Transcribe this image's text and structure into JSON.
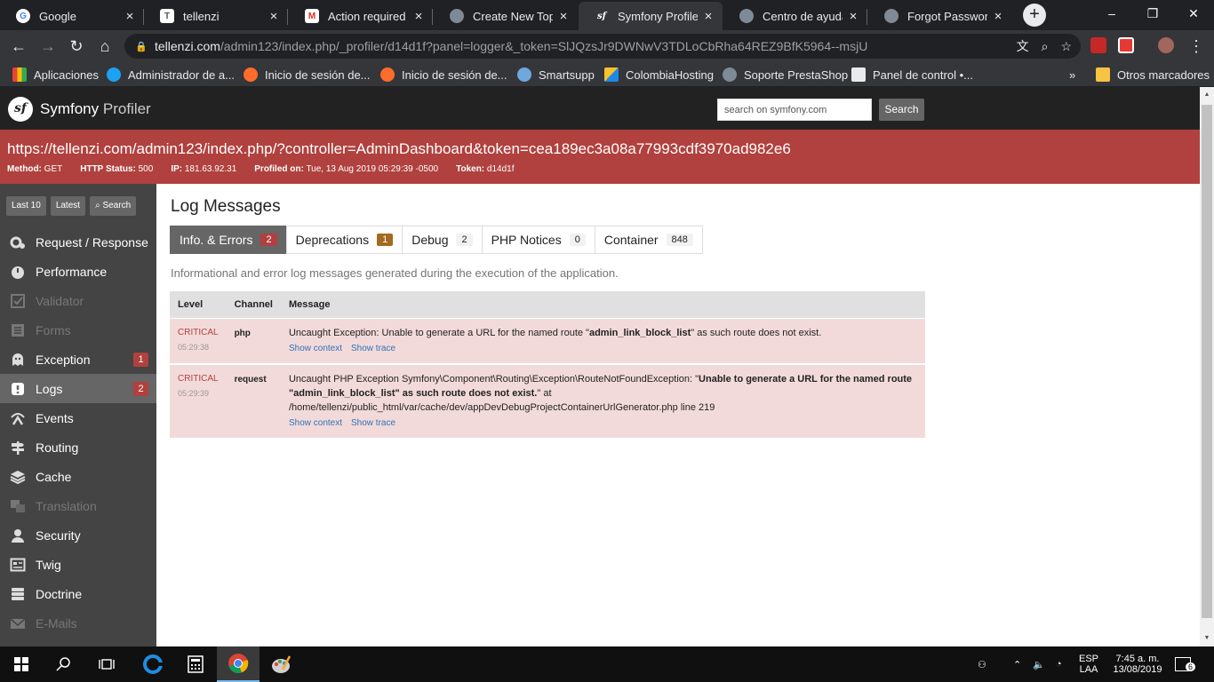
{
  "browser": {
    "tabs": [
      {
        "title": "Google",
        "favicon": "google-icon",
        "color": "#ffffff"
      },
      {
        "title": "tellenzi",
        "favicon": "page-icon",
        "color": "#ffffff"
      },
      {
        "title": "Action required to",
        "favicon": "gmail-icon",
        "color": "#ffffff"
      },
      {
        "title": "Create New Topic",
        "favicon": "prestashop-icon",
        "color": "#ffffff"
      },
      {
        "title": "Symfony Profiler",
        "favicon": "symfony-icon",
        "color": "#ffffff"
      },
      {
        "title": "Centro de ayuda d",
        "favicon": "prestashop-icon",
        "color": "#ffffff"
      },
      {
        "title": "Forgot Password",
        "favicon": "prestashop-icon",
        "color": "#ffffff"
      }
    ],
    "address": {
      "host": "tellenzi.com",
      "path": "/admin123/index.php/_profiler/d14d1f?panel=logger&_token=SlJQzsJr9DWNwV3TDLoCbRha64REZ9BfK5964--msjU"
    },
    "bookmarks": [
      {
        "label": "Aplicaciones"
      },
      {
        "label": "Administrador de a..."
      },
      {
        "label": "Inicio de sesión de..."
      },
      {
        "label": "Inicio de sesión de..."
      },
      {
        "label": "Smartsupp"
      },
      {
        "label": "ColombiaHosting"
      },
      {
        "label": "Soporte PrestaShop"
      },
      {
        "label": "Panel de control •..."
      }
    ],
    "bookmarks_more": "»",
    "other_bookmarks": "Otros marcadores"
  },
  "header": {
    "brand_main": "Symfony",
    "brand_light": "Profiler",
    "search_placeholder": "search on symfony.com",
    "search_button": "Search"
  },
  "summary": {
    "url": "https://tellenzi.com/admin123/index.php/?controller=AdminDashboard&token=cea189ec3a08a77993cdf3970ad982e6",
    "method_label": "Method:",
    "method": "GET",
    "status_label": "HTTP Status:",
    "status": "500",
    "ip_label": "IP:",
    "ip": "181.63.92.31",
    "profiled_label": "Profiled on:",
    "profiled": "Tue, 13 Aug 2019 05:29:39 -0500",
    "token_label": "Token:",
    "token": "d14d1f"
  },
  "sidebar": {
    "last10": "Last 10",
    "latest": "Latest",
    "search": "Search",
    "items": [
      {
        "label": "Request / Response"
      },
      {
        "label": "Performance"
      },
      {
        "label": "Validator"
      },
      {
        "label": "Forms"
      },
      {
        "label": "Exception",
        "count": "1"
      },
      {
        "label": "Logs",
        "count": "2"
      },
      {
        "label": "Events"
      },
      {
        "label": "Routing"
      },
      {
        "label": "Cache"
      },
      {
        "label": "Translation"
      },
      {
        "label": "Security"
      },
      {
        "label": "Twig"
      },
      {
        "label": "Doctrine"
      },
      {
        "label": "E-Mails"
      }
    ]
  },
  "main": {
    "title": "Log Messages",
    "tabs": [
      {
        "label": "Info. & Errors",
        "count": "2"
      },
      {
        "label": "Deprecations",
        "count": "1"
      },
      {
        "label": "Debug",
        "count": "2"
      },
      {
        "label": "PHP Notices",
        "count": "0"
      },
      {
        "label": "Container",
        "count": "848"
      }
    ],
    "description": "Informational and error log messages generated during the execution of the application.",
    "columns": {
      "level": "Level",
      "channel": "Channel",
      "message": "Message"
    },
    "rows": [
      {
        "level": "CRITICAL",
        "time": "05:29:38",
        "channel": "php",
        "msg_pre": "Uncaught Exception: Unable to generate a URL for the named route \"",
        "msg_bold": "admin_link_block_list",
        "msg_post": "\" as such route does not exist.",
        "show_context": "Show context",
        "show_trace": "Show trace"
      },
      {
        "level": "CRITICAL",
        "time": "05:29:39",
        "channel": "request",
        "msg_pre": "Uncaught PHP Exception Symfony\\Component\\Routing\\Exception\\RouteNotFoundException: \"",
        "msg_bold": "Unable to generate a URL for the named route \"admin_link_block_list\" as such route does not exist.",
        "msg_post": "\" at /home/tellenzi/public_html/var/cache/dev/appDevDebugProjectContainerUrlGenerator.php line 219",
        "show_context": "Show context",
        "show_trace": "Show trace"
      }
    ]
  },
  "taskbar": {
    "lang_top": "ESP",
    "lang_bottom": "LAA",
    "time": "7:45 a. m.",
    "date": "13/08/2019",
    "notifications": "6"
  },
  "colors": {
    "accent_red": "#b0413e",
    "sidebar": "#444444",
    "header": "#222222",
    "warning": "#a46a1f"
  }
}
